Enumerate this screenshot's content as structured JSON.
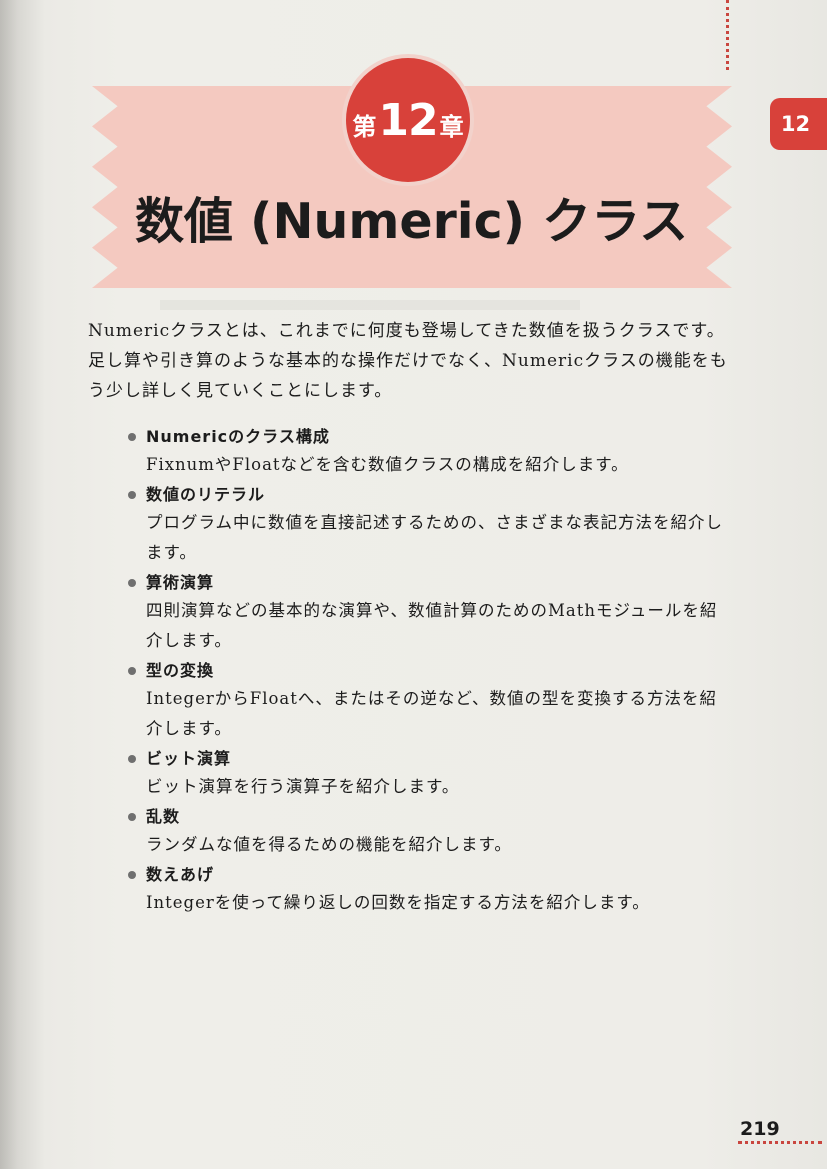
{
  "chapter": {
    "prefix": "第",
    "number": "12",
    "suffix": "章",
    "title": "数値 (Numeric) クラス",
    "tab_number": "12"
  },
  "intro": "Numericクラスとは、これまでに何度も登場してきた数値を扱うクラスです。足し算や引き算のような基本的な操作だけでなく、Numericクラスの機能をもう少し詳しく見ていくことにします。",
  "topics": [
    {
      "title": "Numericのクラス構成",
      "description": "FixnumやFloatなどを含む数値クラスの構成を紹介します。"
    },
    {
      "title": "数値のリテラル",
      "description": "プログラム中に数値を直接記述するための、さまざまな表記方法を紹介します。"
    },
    {
      "title": "算術演算",
      "description": "四則演算などの基本的な演算や、数値計算のためのMathモジュールを紹介します。"
    },
    {
      "title": "型の変換",
      "description": "IntegerからFloatへ、またはその逆など、数値の型を変換する方法を紹介します。"
    },
    {
      "title": "ビット演算",
      "description": "ビット演算を行う演算子を紹介します。"
    },
    {
      "title": "乱数",
      "description": "ランダムな値を得るための機能を紹介します。"
    },
    {
      "title": "数えあげ",
      "description": "Integerを使って繰り返しの回数を指定する方法を紹介します。"
    }
  ],
  "page_number": "219",
  "colors": {
    "accent": "#d8413a",
    "banner": "#f4c9c0"
  }
}
